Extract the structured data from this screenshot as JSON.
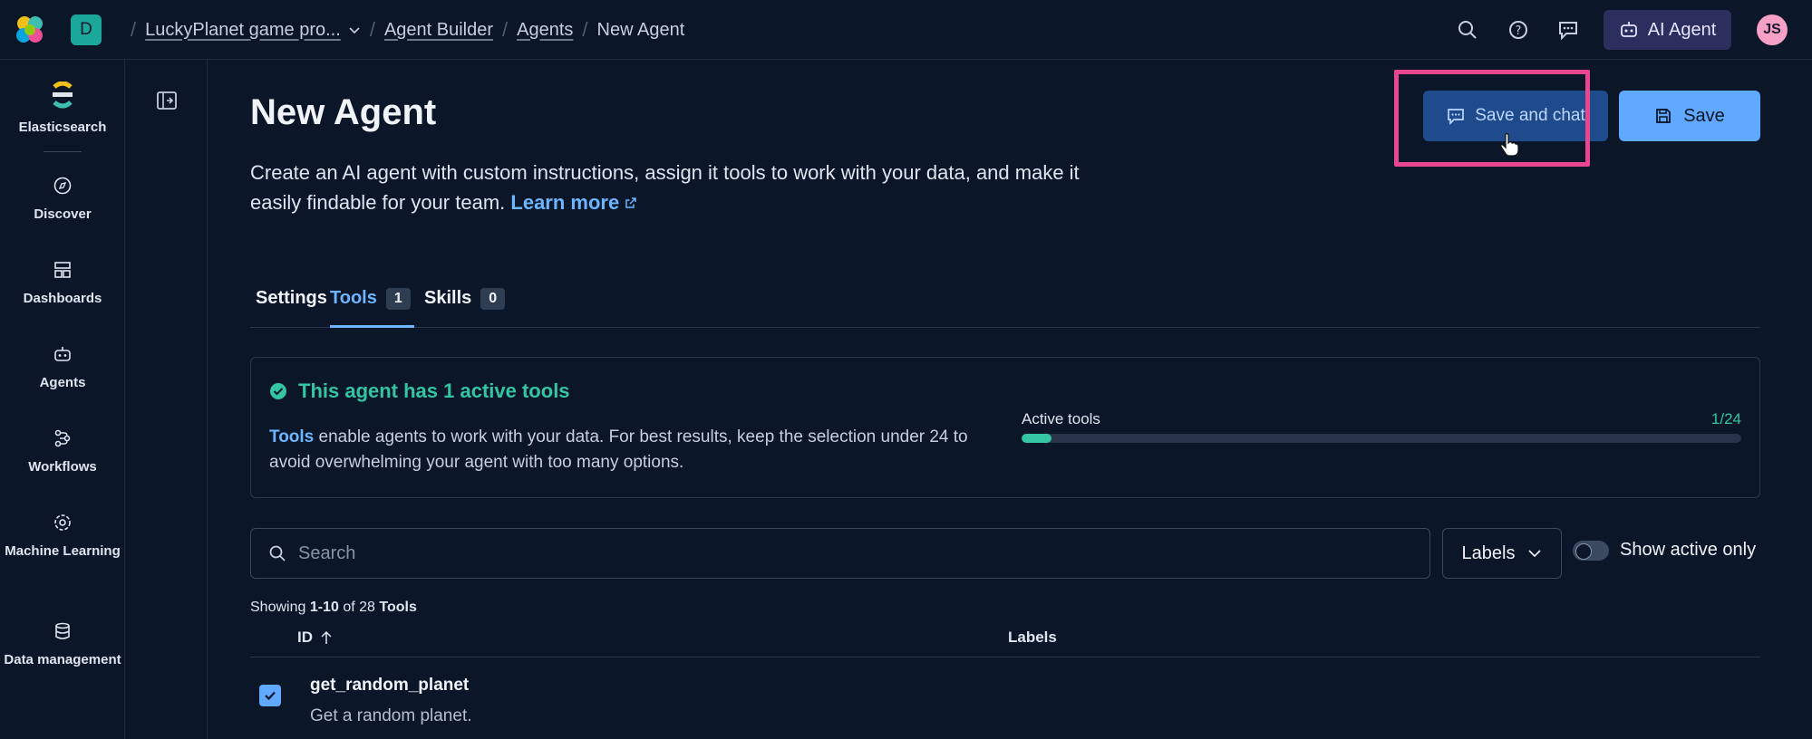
{
  "header": {
    "space_initial": "D",
    "breadcrumbs": [
      "LuckyPlanet game pro...",
      "Agent Builder",
      "Agents",
      "New Agent"
    ],
    "ai_agent_label": "AI Agent",
    "avatar_initials": "JS"
  },
  "sidebar": {
    "items": [
      {
        "label": "Elasticsearch",
        "icon": "elasticsearch-icon"
      },
      {
        "label": "Discover",
        "icon": "compass-icon"
      },
      {
        "label": "Dashboards",
        "icon": "dashboard-icon"
      },
      {
        "label": "Agents",
        "icon": "robot-icon"
      },
      {
        "label": "Workflows",
        "icon": "workflow-icon"
      },
      {
        "label": "Machine Learning",
        "icon": "ml-icon"
      },
      {
        "label": "Data management",
        "icon": "database-icon"
      }
    ]
  },
  "page": {
    "title": "New Agent",
    "description": "Create an AI agent with custom instructions, assign it tools to work with your data, and make it easily findable for your team.",
    "learn_more": "Learn more",
    "save_and_chat": "Save and chat",
    "save": "Save"
  },
  "tabs": [
    {
      "label": "Settings",
      "count": null
    },
    {
      "label": "Tools",
      "count": "1",
      "active": true
    },
    {
      "label": "Skills",
      "count": "0"
    }
  ],
  "callout": {
    "title": "This agent has 1 active tools",
    "tools_link": "Tools",
    "text": "enable agents to work with your data. For best results, keep the selection under 24 to avoid overwhelming your agent with too many options.",
    "progress_label": "Active tools",
    "progress_count": "1/24",
    "progress_fraction": 0.0417
  },
  "filters": {
    "search_placeholder": "Search",
    "labels_button": "Labels",
    "show_active_label": "Show active only"
  },
  "table": {
    "showing_prefix": "Showing",
    "showing_range": "1-10",
    "showing_of": "of 28",
    "showing_suffix": "Tools",
    "columns": [
      "ID",
      "Labels"
    ],
    "rows": [
      {
        "name": "get_random_planet",
        "description": "Get a random planet."
      }
    ]
  },
  "colors": {
    "background": "#0b1628",
    "accent": "#61a8ff",
    "success": "#36c5a2",
    "highlight": "#e8468f"
  }
}
